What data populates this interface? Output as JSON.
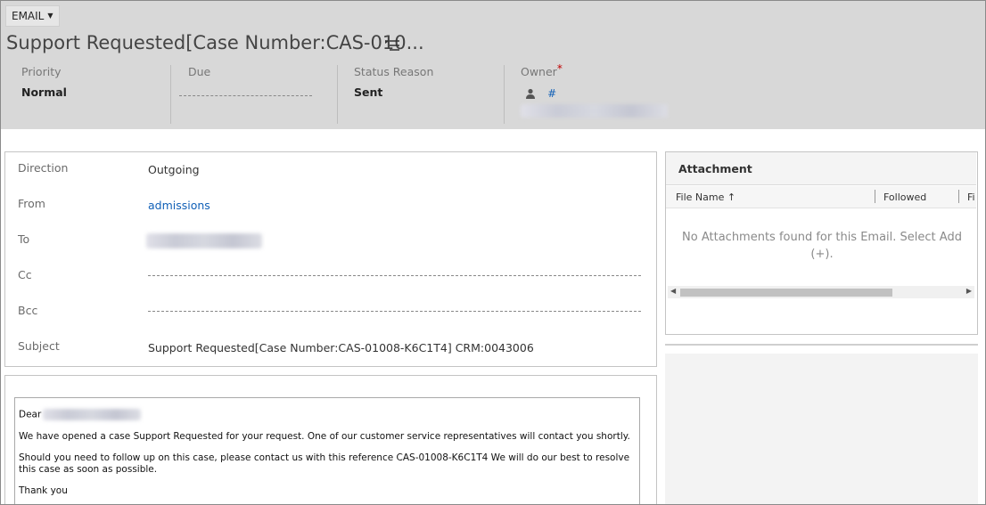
{
  "header": {
    "entity_label": "EMAIL",
    "title": "Support Requested[Case Number:CAS-010...",
    "fields": {
      "priority": {
        "label": "Priority",
        "value": "Normal"
      },
      "due": {
        "label": "Due"
      },
      "status_reason": {
        "label": "Status Reason",
        "value": "Sent"
      },
      "owner": {
        "label": "Owner",
        "required_marker": "*",
        "link_text": "#"
      }
    }
  },
  "form": {
    "direction": {
      "label": "Direction",
      "value": "Outgoing"
    },
    "from": {
      "label": "From",
      "value": "admissions"
    },
    "to": {
      "label": "To"
    },
    "cc": {
      "label": "Cc"
    },
    "bcc": {
      "label": "Bcc"
    },
    "subject": {
      "label": "Subject",
      "value": "Support Requested[Case Number:CAS-01008-K6C1T4] CRM:0043006"
    }
  },
  "email_body": {
    "greeting": "Dear",
    "line1": "We have opened a case Support Requested for your request. One of our customer service representatives will contact you shortly.",
    "line2a": "Should you need to follow up on this case, please contact us with this reference CAS-01008-K6C1T4 We will do our best to resolve",
    "line2b": "this case as soon as possible.",
    "closing": "Thank you"
  },
  "attachment": {
    "title": "Attachment",
    "columns": [
      "File Name",
      "Followed",
      "Fi"
    ],
    "sort_icon": "arrow-up-icon",
    "empty_line1": "No Attachments found for this Email. Select Add",
    "empty_line2": "(+)."
  }
}
